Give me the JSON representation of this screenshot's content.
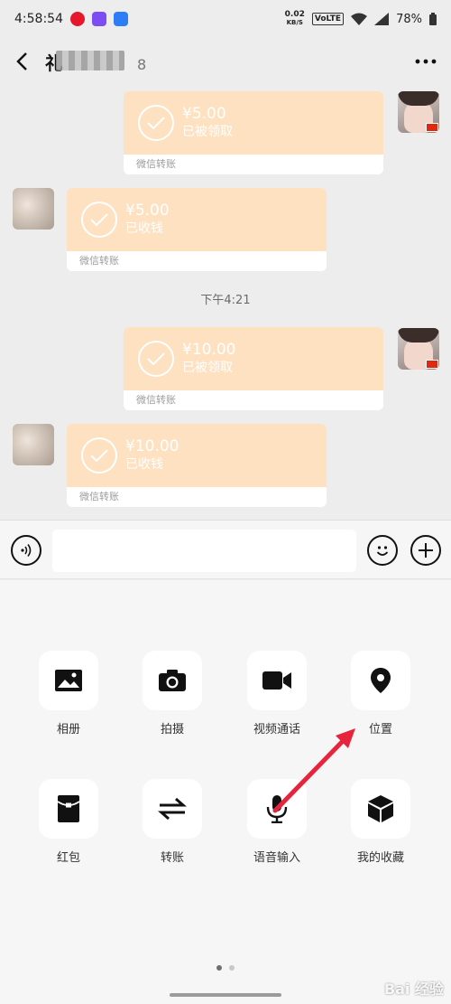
{
  "status_bar": {
    "time": "4:58:54",
    "net_speed_value": "0.02",
    "net_speed_unit": "KB/S",
    "network_type": "VoLTE",
    "battery": "78%"
  },
  "header": {
    "title": "礼",
    "title_tail": "8"
  },
  "messages": [
    {
      "sender": "self",
      "amount": "¥5.00",
      "status": "已被领取",
      "footer": "微信转账"
    },
    {
      "sender": "other",
      "amount": "¥5.00",
      "status": "已收钱",
      "footer": "微信转账"
    },
    {
      "sender": "self",
      "amount": "¥10.00",
      "status": "已被领取",
      "footer": "微信转账"
    },
    {
      "sender": "other",
      "amount": "¥10.00",
      "status": "已收钱",
      "footer": "微信转账"
    }
  ],
  "time_separator": "下午4:21",
  "input": {
    "value": "",
    "placeholder": ""
  },
  "tools": [
    {
      "label": "相册",
      "icon": "album-icon"
    },
    {
      "label": "拍摄",
      "icon": "camera-icon"
    },
    {
      "label": "视频通话",
      "icon": "video-call-icon"
    },
    {
      "label": "位置",
      "icon": "location-icon"
    },
    {
      "label": "红包",
      "icon": "red-packet-icon"
    },
    {
      "label": "转账",
      "icon": "transfer-icon"
    },
    {
      "label": "语音输入",
      "icon": "microphone-icon"
    },
    {
      "label": "我的收藏",
      "icon": "favorites-icon"
    }
  ],
  "pager": {
    "pages": 2,
    "current": 1
  },
  "colors": {
    "transfer_card": "#fde1c1",
    "annotation_arrow": "#e8233c",
    "background": "#ededed"
  },
  "watermark": "Bai 经验"
}
